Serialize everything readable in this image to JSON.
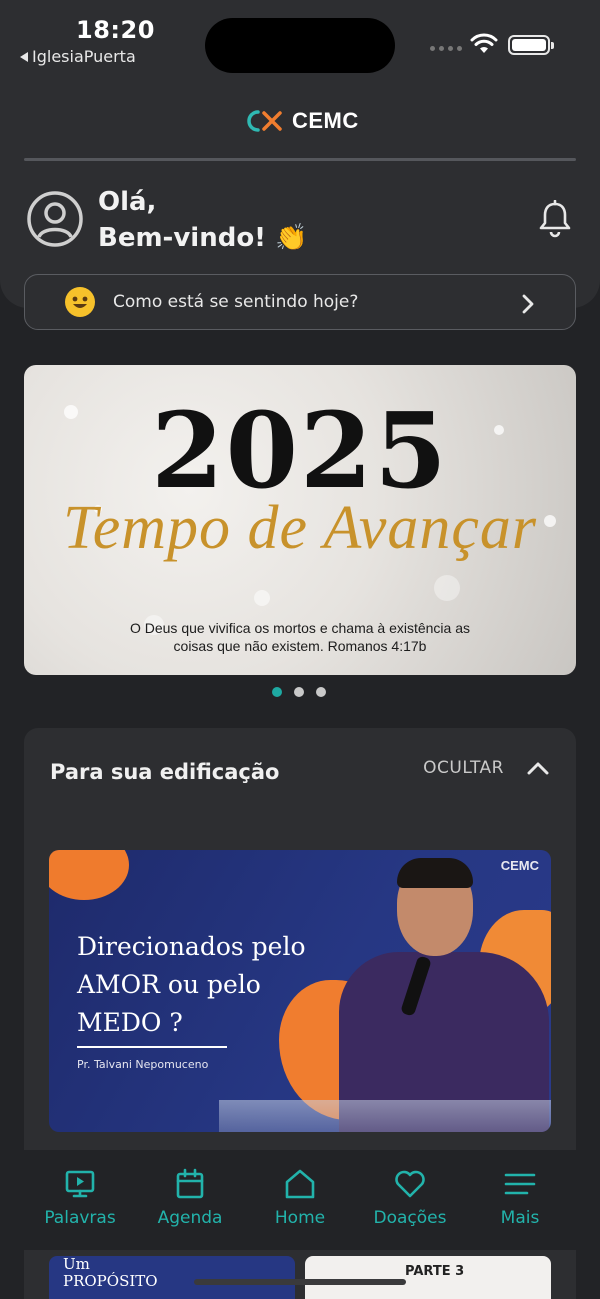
{
  "status_bar": {
    "time": "18:20",
    "back_app": "IglesiaPuerta"
  },
  "header": {
    "logo_text": "CEMC",
    "greeting_line1": "Olá,",
    "greeting_line2": "Bem-vindo! 👏"
  },
  "mood": {
    "label": "Como está se sentindo hoje?"
  },
  "banner": {
    "year": "2025",
    "script_title": "Tempo de Avançar",
    "verse_line1": "O Deus que vivifica os mortos e chama à existência as",
    "verse_line2": "coisas que não  existem. Romanos 4:17b",
    "dots": [
      true,
      false,
      false
    ]
  },
  "edification": {
    "title": "Para sua edificação",
    "hide_label": "OCULTAR",
    "video": {
      "logo": "CEMC",
      "title_line1": "Direcionados pelo",
      "title_line2": "AMOR ou pelo",
      "title_line3": "MEDO ?",
      "author": "Pr. Talvani Nepomuceno"
    },
    "peek_left_line1": "Um",
    "peek_left_line2": "PROPÓSITO",
    "peek_right": "PARTE 3"
  },
  "tabbar": {
    "items": [
      {
        "label": "Palavras",
        "icon": "monitor-play-icon"
      },
      {
        "label": "Agenda",
        "icon": "calendar-icon"
      },
      {
        "label": "Home",
        "icon": "home-icon"
      },
      {
        "label": "Doações",
        "icon": "heart-icon"
      },
      {
        "label": "Mais",
        "icon": "menu-icon"
      }
    ],
    "accent": "#22b3ab"
  }
}
